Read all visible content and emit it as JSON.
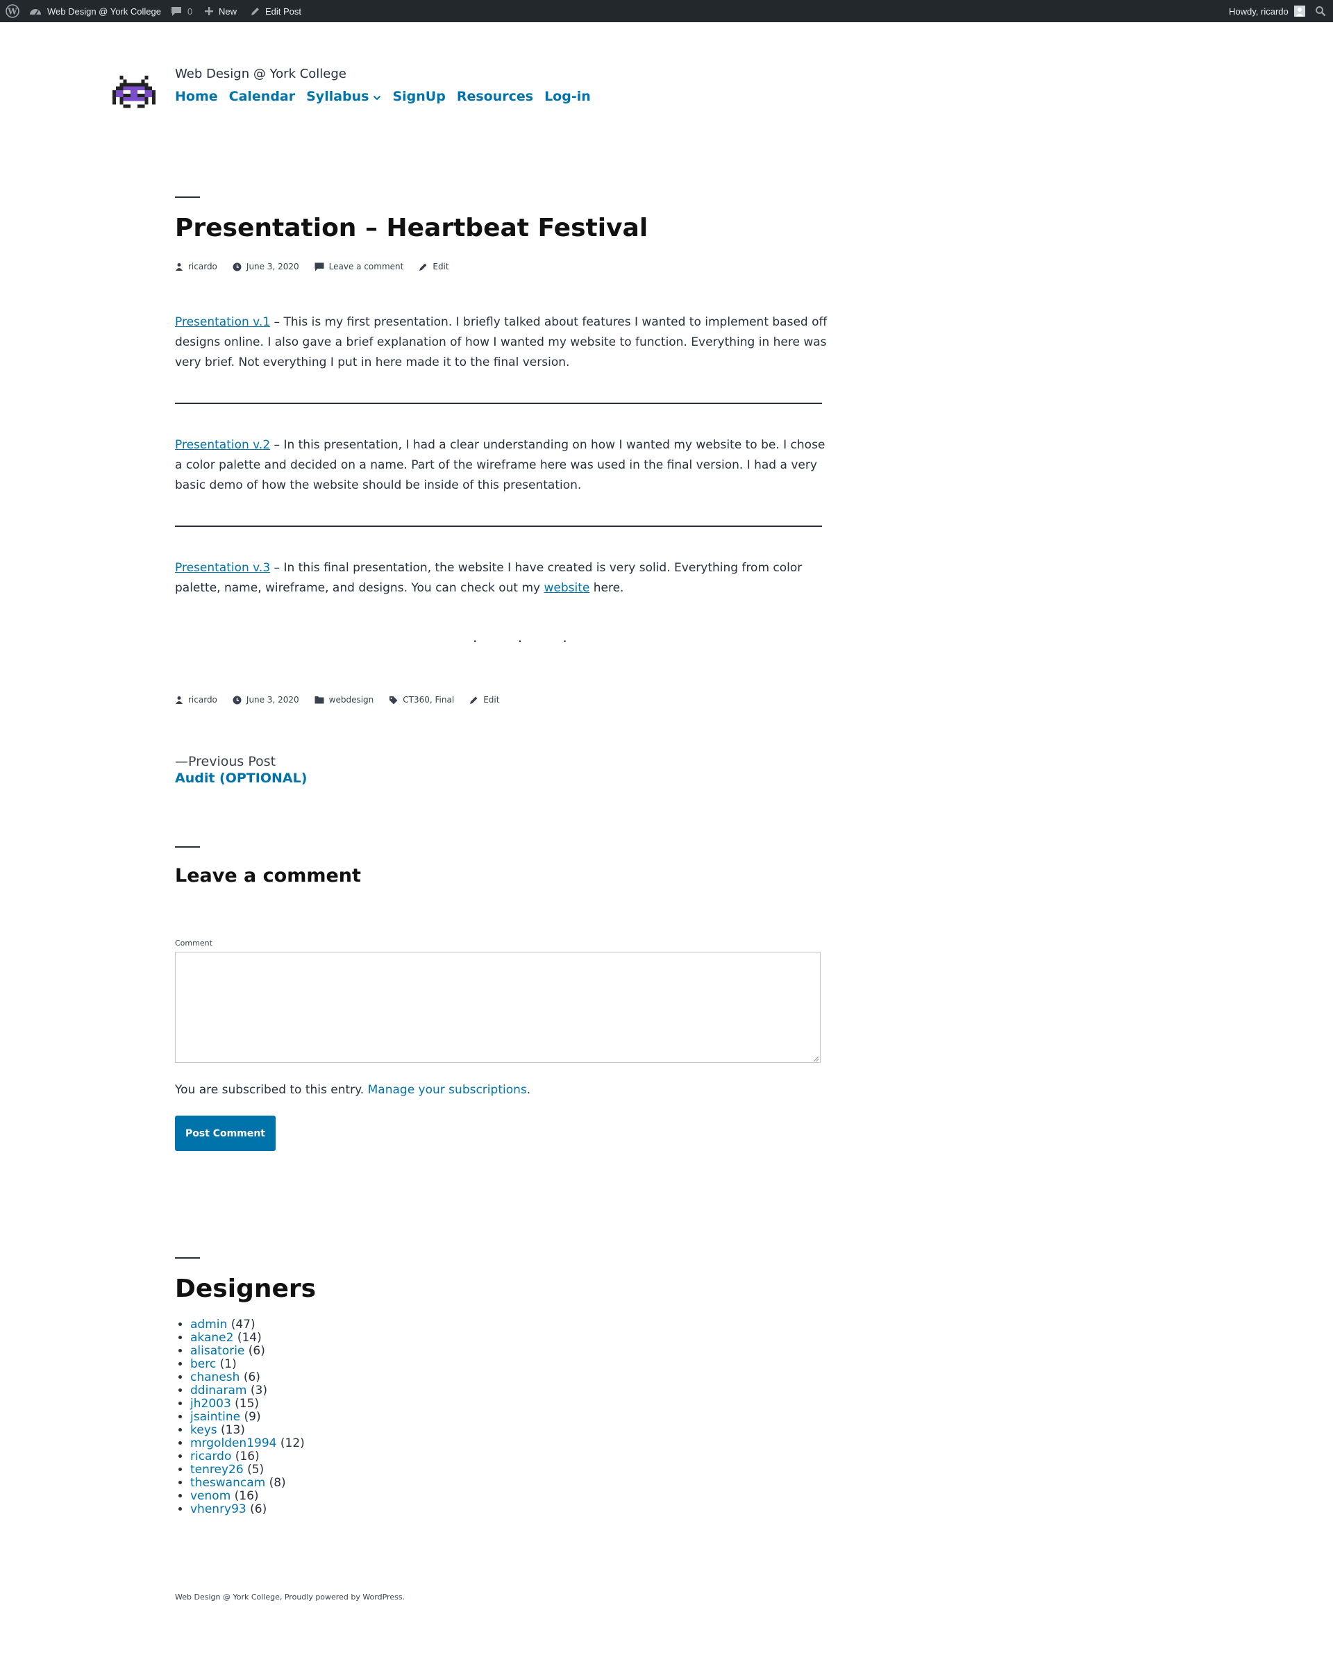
{
  "adminbar": {
    "site_name": "Web Design @ York College",
    "comments_count": "0",
    "new_label": "New",
    "edit_post_label": "Edit Post",
    "howdy": "Howdy, ricardo"
  },
  "header": {
    "site_title": "Web Design @ York College",
    "nav": [
      "Home",
      "Calendar",
      "Syllabus",
      "SignUp",
      "Resources",
      "Log-in"
    ]
  },
  "post": {
    "title": "Presentation – Heartbeat Festival",
    "meta_top": {
      "author": "ricardo",
      "date": "June 3, 2020",
      "comment_link": "Leave a comment",
      "edit": "Edit"
    },
    "paragraphs": [
      {
        "link": "Presentation v.1",
        "text": " – This is my first presentation. I briefly talked about features I wanted to implement based off designs online. I also gave a brief explanation of how I wanted my website to function. Everything in here was very brief. Not everything I put in here made it to the final version."
      },
      {
        "link": "Presentation v.2",
        "text": " – In this presentation, I had a clear understanding on how I wanted my website to be. I chose a color palette and decided on a name. Part of the wireframe here was used in the final version. I had a very basic demo of how the website should be inside of this presentation."
      },
      {
        "link": "Presentation v.3",
        "text": " – In this final presentation, the website I have created is very solid. Everything from color palette, name, wireframe, and designs. You can check out my ",
        "inline_link": "website",
        "text_after": " here."
      }
    ],
    "separator_dots": "· · ·",
    "meta_bottom": {
      "author": "ricardo",
      "date": "June 3, 2020",
      "category": "webdesign",
      "tags": "CT360, Final",
      "edit": "Edit"
    }
  },
  "post_nav": {
    "previous_label": "—Previous Post",
    "previous_title": "Audit (OPTIONAL)"
  },
  "comments": {
    "title": "Leave a comment",
    "field_label": "Comment",
    "subscribed_text": "You are subscribed to this entry.",
    "manage_link": "Manage your subscriptions",
    "period": ".",
    "submit_label": "Post Comment"
  },
  "designers": {
    "title": "Designers",
    "items": [
      {
        "name": "admin",
        "count": "(47)"
      },
      {
        "name": "akane2",
        "count": "(14)"
      },
      {
        "name": "alisatorie",
        "count": "(6)"
      },
      {
        "name": "berc",
        "count": "(1)"
      },
      {
        "name": "chanesh",
        "count": "(6)"
      },
      {
        "name": "ddinaram",
        "count": "(3)"
      },
      {
        "name": "jh2003",
        "count": "(15)"
      },
      {
        "name": "jsaintine",
        "count": "(9)"
      },
      {
        "name": "keys",
        "count": "(13)"
      },
      {
        "name": "mrgolden1994",
        "count": "(12)"
      },
      {
        "name": "ricardo",
        "count": "(16)"
      },
      {
        "name": "tenrey26",
        "count": "(5)"
      },
      {
        "name": "theswancam",
        "count": "(8)"
      },
      {
        "name": "venom",
        "count": "(16)"
      },
      {
        "name": "vhenry93",
        "count": "(6)"
      }
    ]
  },
  "footer": {
    "text": "Web Design @ York College, Proudly powered by WordPress."
  }
}
